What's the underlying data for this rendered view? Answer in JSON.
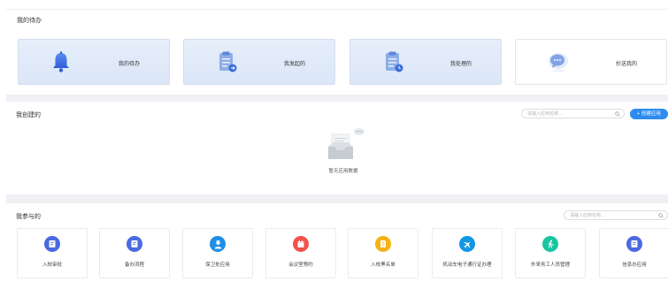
{
  "todo": {
    "title": "我的待办",
    "cards": [
      {
        "label": "我的待办",
        "icon": "bell-icon"
      },
      {
        "label": "我发起的",
        "icon": "clipboard-send-icon"
      },
      {
        "label": "我处理的",
        "icon": "clipboard-clock-icon"
      },
      {
        "label": "抄送我的",
        "icon": "chat-bubble-icon"
      }
    ]
  },
  "created": {
    "title": "我创建的",
    "search_placeholder": "请输入应用名称...",
    "create_button": "+ 创建应用",
    "empty_text": "暂无应用数据"
  },
  "joined": {
    "title": "我参与的",
    "search_placeholder": "请输入应用名称...",
    "apps": [
      {
        "name": "入校审批",
        "icon": "document-edit-icon",
        "color": "#4a69e2"
      },
      {
        "name": "备办流程",
        "icon": "document-edit-icon",
        "color": "#4a69e2"
      },
      {
        "name": "保卫处应用",
        "icon": "security-officer-icon",
        "color": "#1d8fe8"
      },
      {
        "name": "会议室预约",
        "icon": "calendar-icon",
        "color": "#f0524c"
      },
      {
        "name": "入校黑名单",
        "icon": "notebook-icon",
        "color": "#f5b212"
      },
      {
        "name": "机动车电子通行证办理",
        "icon": "airplane-icon",
        "color": "#1296e6"
      },
      {
        "name": "外来务工人员管理",
        "icon": "runner-icon",
        "color": "#19c6a0"
      },
      {
        "name": "信息办应用",
        "icon": "document-edit-icon",
        "color": "#4a69e2"
      }
    ]
  }
}
